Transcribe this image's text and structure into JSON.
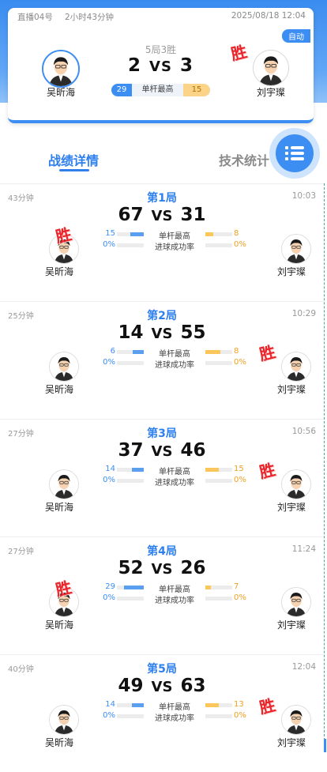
{
  "header": {
    "room": "直播04号",
    "duration": "2小时43分钟",
    "datetime": "2025/08/18 12:04",
    "mode": "自动",
    "record": "5局3胜",
    "score_left": "2",
    "vs": "VS",
    "score_right": "3",
    "left_player": "吴昕海",
    "right_player": "刘宇璨",
    "highest_left": "29",
    "highest_label": "单杆最高",
    "highest_right": "15",
    "winner_mark": "胜"
  },
  "tabs": [
    {
      "label": "战绩详情",
      "active": true
    },
    {
      "label": "技术统计",
      "active": false
    }
  ],
  "menu_icon": "list-menu-icon",
  "labels": {
    "highest": "单杆最高",
    "success_rate": "进球成功率",
    "vs": "VS",
    "win": "胜"
  },
  "games": [
    {
      "duration": "43分钟",
      "title": "第1局",
      "time": "10:03",
      "left_score": "67",
      "right_score": "31",
      "left_high": "15",
      "left_high_pct": 0.5,
      "right_high": "8",
      "right_high_pct": 0.3,
      "left_rate": "0%",
      "right_rate": "0%",
      "left_player": "吴昕海",
      "right_player": "刘宇璨",
      "winner": "left"
    },
    {
      "duration": "25分钟",
      "title": "第2局",
      "time": "10:29",
      "left_score": "14",
      "right_score": "55",
      "left_high": "6",
      "left_high_pct": 0.4,
      "right_high": "8",
      "right_high_pct": 0.55,
      "left_rate": "0%",
      "right_rate": "0%",
      "left_player": "吴昕海",
      "right_player": "刘宇璨",
      "winner": "right"
    },
    {
      "duration": "27分钟",
      "title": "第3局",
      "time": "10:56",
      "left_score": "37",
      "right_score": "46",
      "left_high": "14",
      "left_high_pct": 0.45,
      "right_high": "15",
      "right_high_pct": 0.5,
      "left_rate": "0%",
      "right_rate": "0%",
      "left_player": "吴昕海",
      "right_player": "刘宇璨",
      "winner": "right"
    },
    {
      "duration": "27分钟",
      "title": "第4局",
      "time": "11:24",
      "left_score": "52",
      "right_score": "26",
      "left_high": "29",
      "left_high_pct": 0.75,
      "right_high": "7",
      "right_high_pct": 0.2,
      "left_rate": "0%",
      "right_rate": "0%",
      "left_player": "吴昕海",
      "right_player": "刘宇璨",
      "winner": "left"
    },
    {
      "duration": "40分钟",
      "title": "第5局",
      "time": "12:04",
      "left_score": "49",
      "right_score": "63",
      "left_high": "14",
      "left_high_pct": 0.45,
      "right_high": "13",
      "right_high_pct": 0.5,
      "left_rate": "0%",
      "right_rate": "0%",
      "left_player": "吴昕海",
      "right_player": "刘宇璨",
      "winner": "right"
    }
  ],
  "colors": {
    "accent": "#3d8ef2",
    "win": "#e8262b",
    "right_bar": "#fbc65a"
  }
}
